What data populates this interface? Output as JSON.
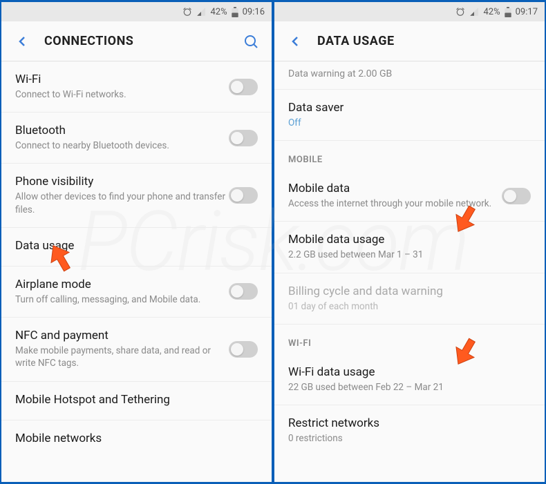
{
  "left": {
    "status": {
      "battery": "42%",
      "time": "09:16"
    },
    "header": {
      "title": "CONNECTIONS"
    },
    "items": {
      "wifi": {
        "title": "Wi-Fi",
        "subtitle": "Connect to Wi-Fi networks."
      },
      "bluetooth": {
        "title": "Bluetooth",
        "subtitle": "Connect to nearby Bluetooth devices."
      },
      "phone_visibility": {
        "title": "Phone visibility",
        "subtitle": "Allow other devices to find your phone and transfer files."
      },
      "data_usage": {
        "title": "Data usage"
      },
      "airplane": {
        "title": "Airplane mode",
        "subtitle": "Turn off calling, messaging, and Mobile data."
      },
      "nfc": {
        "title": "NFC and payment",
        "subtitle": "Make mobile payments, share data, and read or write NFC tags."
      },
      "hotspot": {
        "title": "Mobile Hotspot and Tethering"
      },
      "networks": {
        "title": "Mobile networks"
      }
    }
  },
  "right": {
    "status": {
      "battery": "42%",
      "time": "09:17"
    },
    "header": {
      "title": "DATA USAGE"
    },
    "warning": "Data warning at 2.00 GB",
    "data_saver": {
      "title": "Data saver",
      "status": "Off"
    },
    "sections": {
      "mobile": "MOBILE",
      "wifi": "WI-FI"
    },
    "items": {
      "mobile_data": {
        "title": "Mobile data",
        "subtitle": "Access the internet through your mobile network."
      },
      "mobile_data_usage": {
        "title": "Mobile data usage",
        "subtitle": "2.2 GB used between Mar 1 – 31"
      },
      "billing": {
        "title": "Billing cycle and data warning",
        "subtitle": "01 day of each month"
      },
      "wifi_data_usage": {
        "title": "Wi-Fi data usage",
        "subtitle": "22 GB used between Feb 22 – Mar 21"
      },
      "restrict": {
        "title": "Restrict networks",
        "subtitle": "0 restrictions"
      }
    }
  },
  "watermark": "PCrisk.com"
}
